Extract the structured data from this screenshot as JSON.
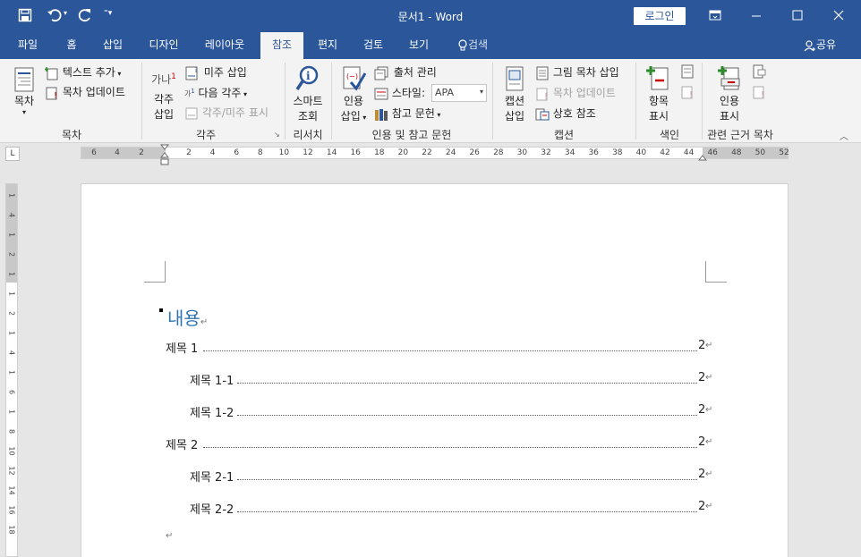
{
  "titlebar": {
    "title": "문서1  -  Word",
    "login": "로그인"
  },
  "tabs": [
    "파일",
    "홈",
    "삽입",
    "디자인",
    "레이아웃",
    "참조",
    "편지",
    "검토",
    "보기"
  ],
  "tell_me": "검색",
  "share": "공유",
  "ribbon": {
    "toc_group": {
      "toc": "목차",
      "add_text": "텍스트 추가",
      "update": "목차 업데이트",
      "label": "목차"
    },
    "footnotes": {
      "insert_line1": "각주",
      "insert_line2": "삽입",
      "endnote": "미주 삽입",
      "next": "다음 각주",
      "show": "각주/미주 표시",
      "label": "각주",
      "icon_text": "가나"
    },
    "research": {
      "smart_line1": "스마트",
      "smart_line2": "조회",
      "label": "리서치"
    },
    "citations": {
      "insert_line1": "인용",
      "insert_line2": "삽입",
      "manage": "출처 관리",
      "style_label": "스타일:",
      "style_value": "APA",
      "bib": "참고 문헌",
      "label": "인용 및 참고 문헌"
    },
    "captions": {
      "insert_line1": "캡션",
      "insert_line2": "삽입",
      "tof": "그림 목차 삽입",
      "update": "목차 업데이트",
      "cross": "상호 참조",
      "label": "캡션"
    },
    "index": {
      "mark_line1": "항목",
      "mark_line2": "표시",
      "label": "색인"
    },
    "toa": {
      "mark_line1": "인용",
      "mark_line2": "표시",
      "label": "관련 근거 목차"
    }
  },
  "ruler": {
    "tab_selector": "L",
    "h_left": [
      "6",
      "4",
      "2"
    ],
    "h_right": [
      "2",
      "4",
      "6",
      "8",
      "10",
      "12",
      "14",
      "16",
      "18",
      "20",
      "22",
      "24",
      "26",
      "28",
      "30",
      "32",
      "34",
      "36",
      "38",
      "40",
      "42",
      "44",
      "46",
      "48",
      "50",
      "52"
    ],
    "v": [
      "1",
      "4",
      "1",
      "2",
      "1",
      "1",
      "2",
      "1",
      "4",
      "1",
      "6",
      "1",
      "8",
      "10",
      "12",
      "14",
      "16",
      "18"
    ]
  },
  "document": {
    "heading": "내용",
    "entries": [
      {
        "text": "제목  1",
        "page": "2",
        "level": 1
      },
      {
        "text": "제목  1-1",
        "page": "2",
        "level": 2
      },
      {
        "text": "제목  1-2",
        "page": "2",
        "level": 2
      },
      {
        "text": "제목  2",
        "page": "2",
        "level": 1
      },
      {
        "text": "제목  2-1",
        "page": "2",
        "level": 2
      },
      {
        "text": "제목  2-2",
        "page": "2",
        "level": 2
      }
    ],
    "para_mark": "↵"
  }
}
